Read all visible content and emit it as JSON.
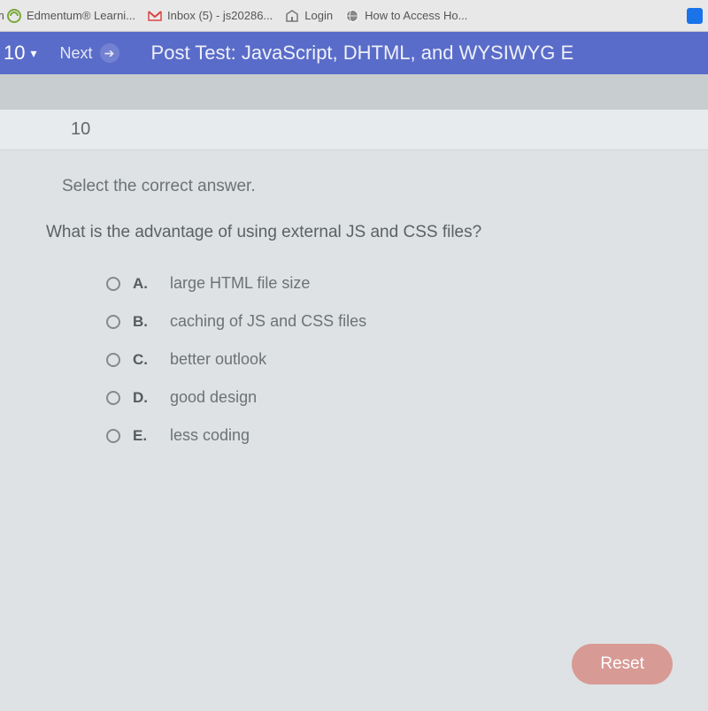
{
  "bookmarks": {
    "edge_char": "m",
    "items": [
      {
        "label": "Edmentum® Learni...",
        "icon": "edmentum"
      },
      {
        "label": "Inbox (5) - js20286...",
        "icon": "gmail"
      },
      {
        "label": "Login",
        "icon": "login"
      },
      {
        "label": "How to Access Ho...",
        "icon": "generic"
      }
    ]
  },
  "bluebar": {
    "selector_value": "10",
    "next_label": "Next",
    "title": "Post Test: JavaScript, DHTML, and WYSIWYG E"
  },
  "question": {
    "number": "10",
    "instruction": "Select the correct answer.",
    "prompt": "What is the advantage of using external JS and CSS files?",
    "answers": [
      {
        "letter": "A.",
        "text": "large HTML file size"
      },
      {
        "letter": "B.",
        "text": "caching of JS and CSS files"
      },
      {
        "letter": "C.",
        "text": "better outlook"
      },
      {
        "letter": "D.",
        "text": "good design"
      },
      {
        "letter": "E.",
        "text": "less coding"
      }
    ]
  },
  "reset_label": "Reset"
}
